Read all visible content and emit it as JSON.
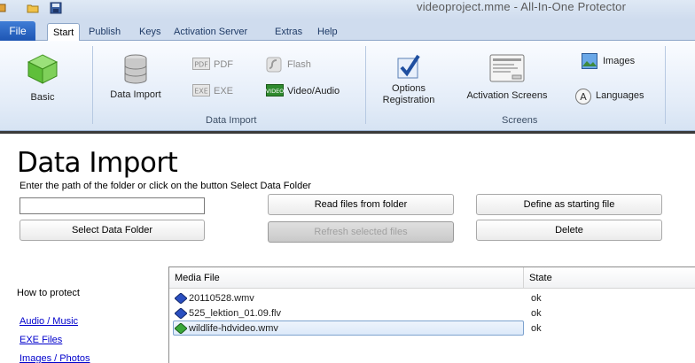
{
  "window": {
    "title": "videoproject.mme  -  All-In-One Protector"
  },
  "tabs": {
    "file": "File",
    "items": [
      "Start",
      "Publish",
      "Keys",
      "Activation Server",
      "Extras",
      "Help"
    ]
  },
  "ribbon": {
    "basic": "Basic",
    "data_import": "Data Import",
    "pdf": "PDF",
    "exe": "EXE",
    "flash": "Flash",
    "video_audio": "Video/Audio",
    "group_data_import": "Data Import",
    "options_registration": [
      "Options",
      "Registration"
    ],
    "activation_screens": "Activation Screens",
    "images": "Images",
    "languages": "Languages",
    "group_screens": "Screens"
  },
  "content": {
    "heading": "Data Import",
    "instruction": "Enter the path of the folder or click on the button Select Data Folder",
    "path_value": "",
    "buttons": {
      "select_folder": "Select Data Folder",
      "read_files": "Read files from folder",
      "refresh_selected": "Refresh selected files",
      "define_start": "Define as starting file",
      "delete": "Delete"
    },
    "howto": "How to protect",
    "links": [
      "Audio / Music",
      "EXE Files",
      "Images / Photos"
    ]
  },
  "list": {
    "columns": [
      "Media File",
      "State"
    ],
    "rows": [
      {
        "name": "20110528.wmv",
        "state": "ok",
        "selected": false
      },
      {
        "name": "525_lektion_01.09.flv",
        "state": "ok",
        "selected": false
      },
      {
        "name": "wildlife-hdvideo.wmv",
        "state": "ok",
        "selected": true
      }
    ]
  }
}
